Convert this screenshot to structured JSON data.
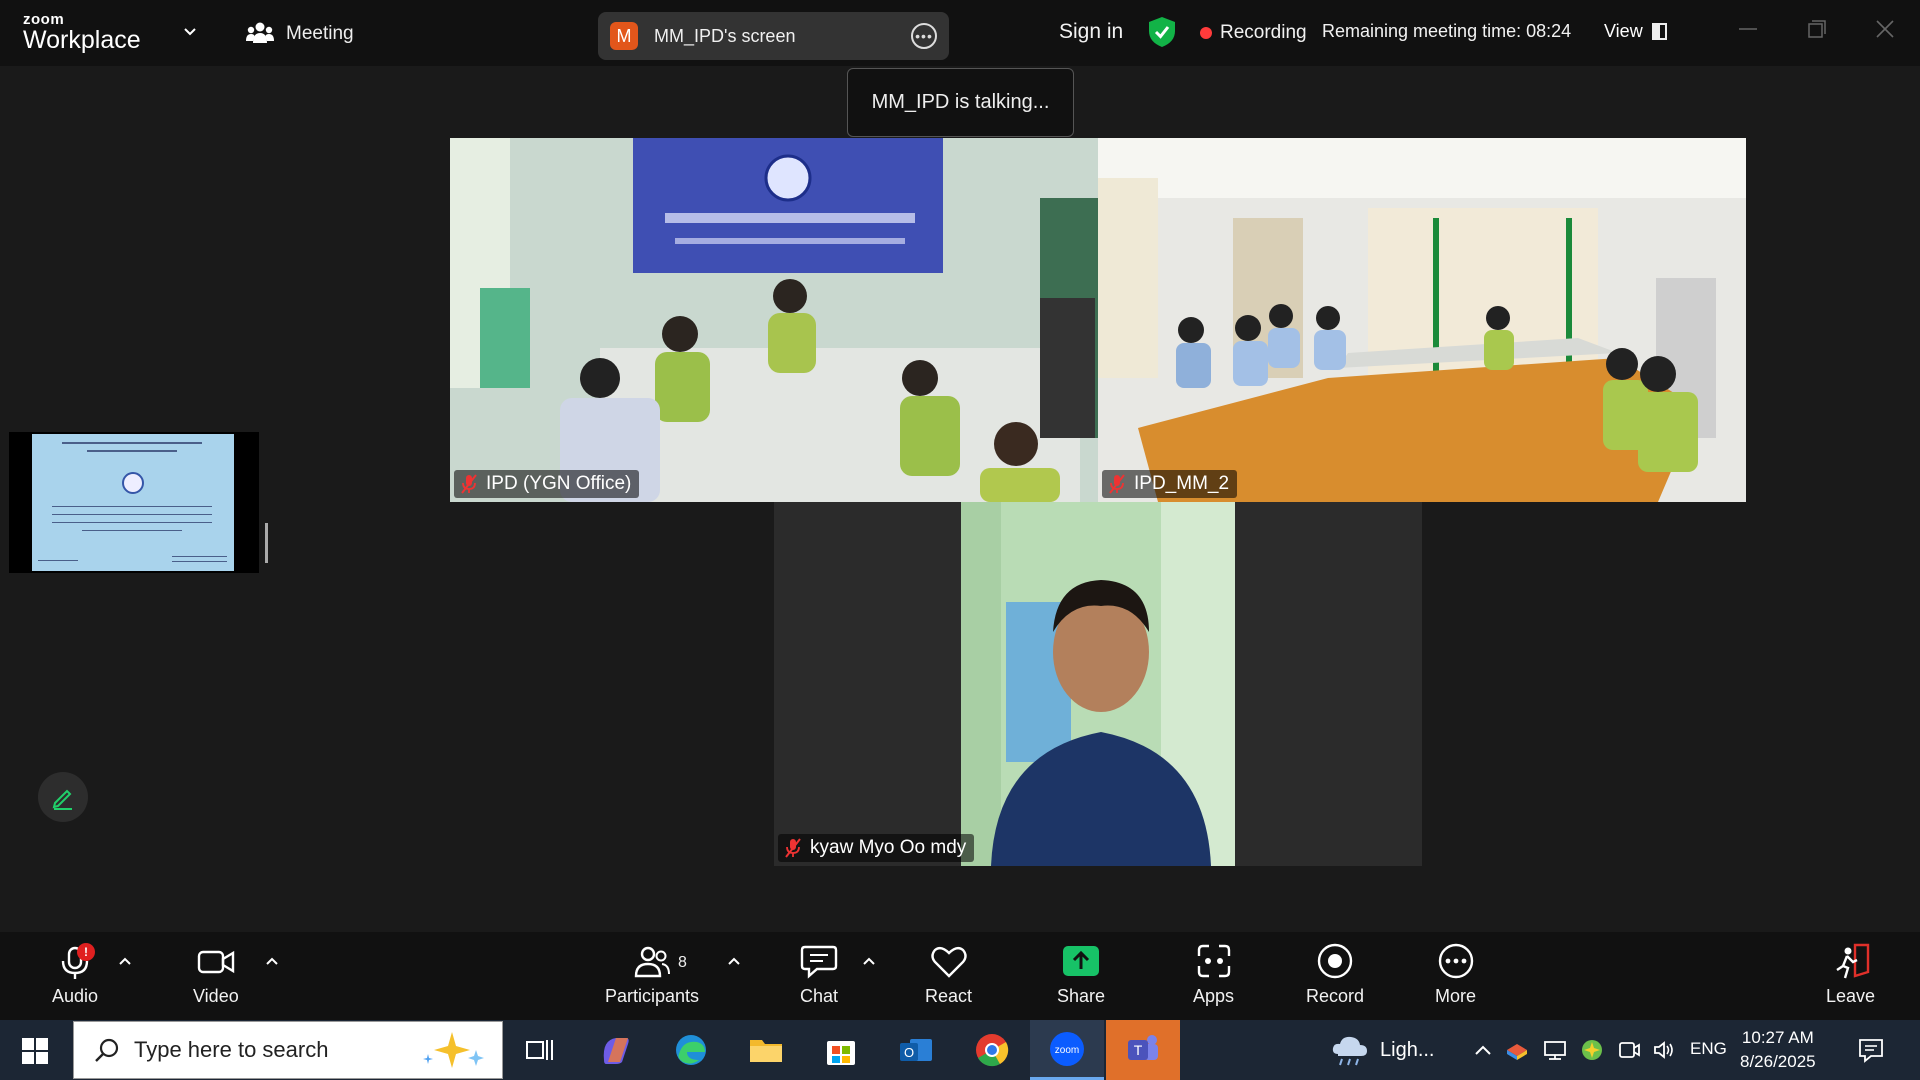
{
  "app": {
    "logo_small": "zoom",
    "logo_big": "Workplace"
  },
  "topbar": {
    "meeting_label": "Meeting",
    "screen_share": {
      "avatar_letter": "M",
      "label": "MM_IPD's screen"
    },
    "sign_in": "Sign in",
    "recording": "Recording",
    "remaining": "Remaining meeting time: 08:24",
    "view": "View"
  },
  "talking_indicator": "MM_IPD is talking...",
  "tiles": [
    {
      "name": "IPD (YGN Office)",
      "muted": true
    },
    {
      "name": "IPD_MM_2",
      "muted": true
    },
    {
      "name": "kyaw Myo Oo mdy",
      "muted": true
    }
  ],
  "toolbar": {
    "audio": "Audio",
    "audio_badge": "!",
    "video": "Video",
    "participants": "Participants",
    "participants_count": "8",
    "chat": "Chat",
    "react": "React",
    "share": "Share",
    "apps": "Apps",
    "record": "Record",
    "more": "More",
    "leave": "Leave"
  },
  "taskbar": {
    "search_placeholder": "Type here to search",
    "weather": "Ligh...",
    "language": "ENG",
    "time": "10:27 AM",
    "date": "8/26/2025"
  },
  "colors": {
    "recording_dot": "#ff3b3b",
    "share_green": "#17c267",
    "shield_green": "#12b347",
    "avatar_orange": "#e2561b",
    "leave_red": "#e0302a"
  }
}
